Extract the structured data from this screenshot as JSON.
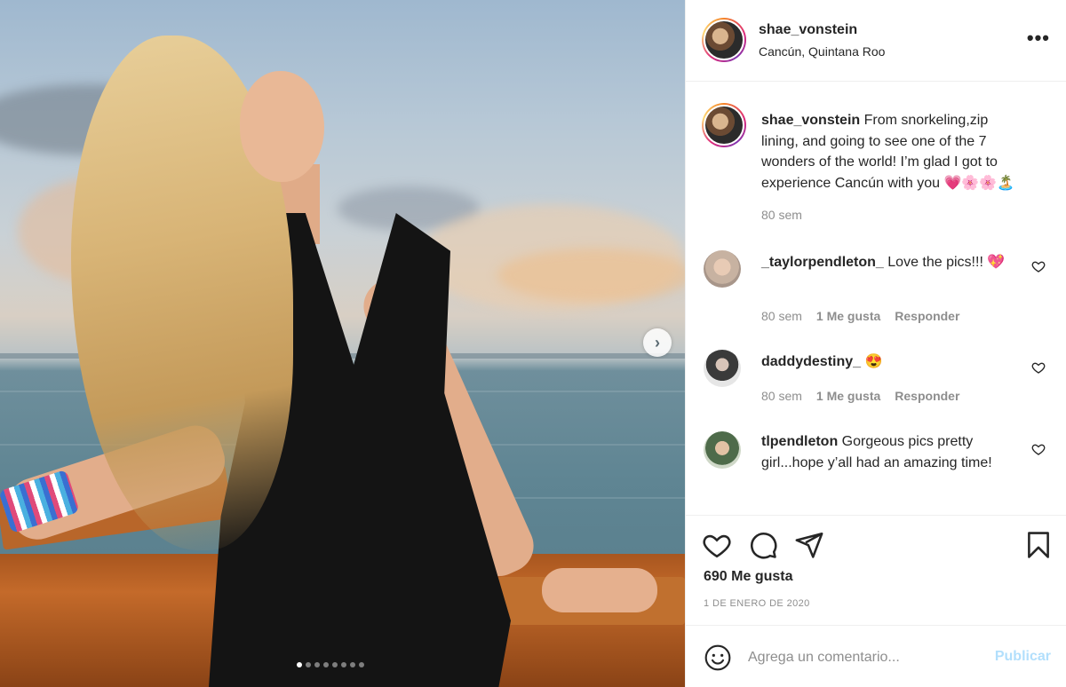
{
  "post": {
    "username": "shae_vonstein",
    "location": "Cancún, Quintana Roo",
    "more_label": "•••",
    "photo": {
      "description_icon": "photo",
      "carousel_next_label": "›",
      "slide_count": 8,
      "active_slide": 1
    }
  },
  "caption": {
    "username": "shae_vonstein",
    "text": "From snorkeling,zip lining, and going to see one of the 7 wonders of the world! I’m glad I got to experience Cancún with you 💗🌸🌸🏝️",
    "time": "80 sem"
  },
  "comments": [
    {
      "username": "_taylorpendleton_",
      "text": "Love the pics!!! 💖",
      "time": "80 sem",
      "likes": "1 Me gusta",
      "reply": "Responder"
    },
    {
      "username": "daddydestiny_",
      "text": "😍",
      "time": "80 sem",
      "likes": "1 Me gusta",
      "reply": "Responder"
    },
    {
      "username": "tlpendleton",
      "text": "Gorgeous pics pretty girl...hope y’all had an amazing time!"
    }
  ],
  "actions": {
    "icons": [
      "heart-icon",
      "comment-icon",
      "share-icon",
      "bookmark-icon"
    ],
    "likes": "690 Me gusta",
    "date": "1 DE ENERO DE 2020"
  },
  "comment_box": {
    "placeholder": "Agrega un comentario...",
    "publish": "Publicar"
  },
  "colors": {
    "publish_disabled": "#b2dffc",
    "meta_text": "#8e8e8e",
    "border": "#efefef"
  }
}
